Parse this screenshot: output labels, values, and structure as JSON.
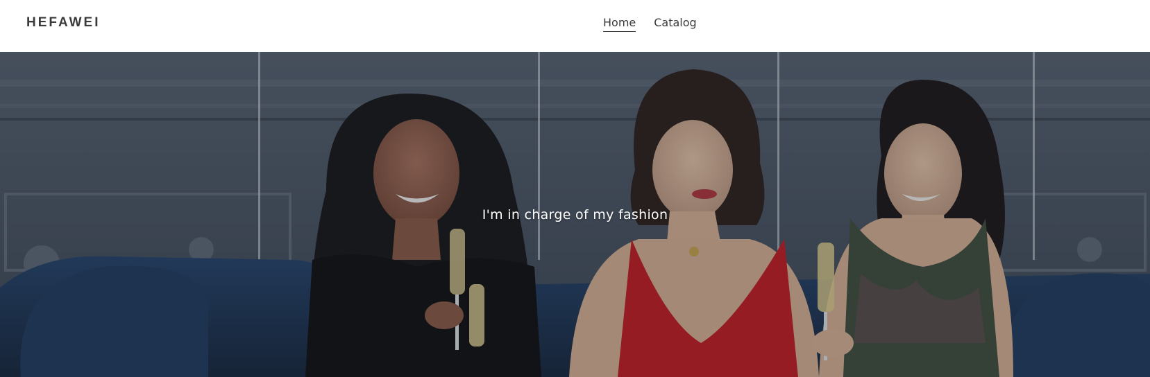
{
  "header": {
    "logo": "HEFAWEI",
    "nav": [
      {
        "label": "Home",
        "active": true
      },
      {
        "label": "Catalog",
        "active": false
      }
    ]
  },
  "hero": {
    "heading": "I'm in charge of my fashion",
    "image_alt": "three-women-on-sofa-with-champagne",
    "colors": {
      "wall": "#4a5563",
      "sofa": "#1e3450",
      "red_dress": "#c41a1e"
    }
  }
}
